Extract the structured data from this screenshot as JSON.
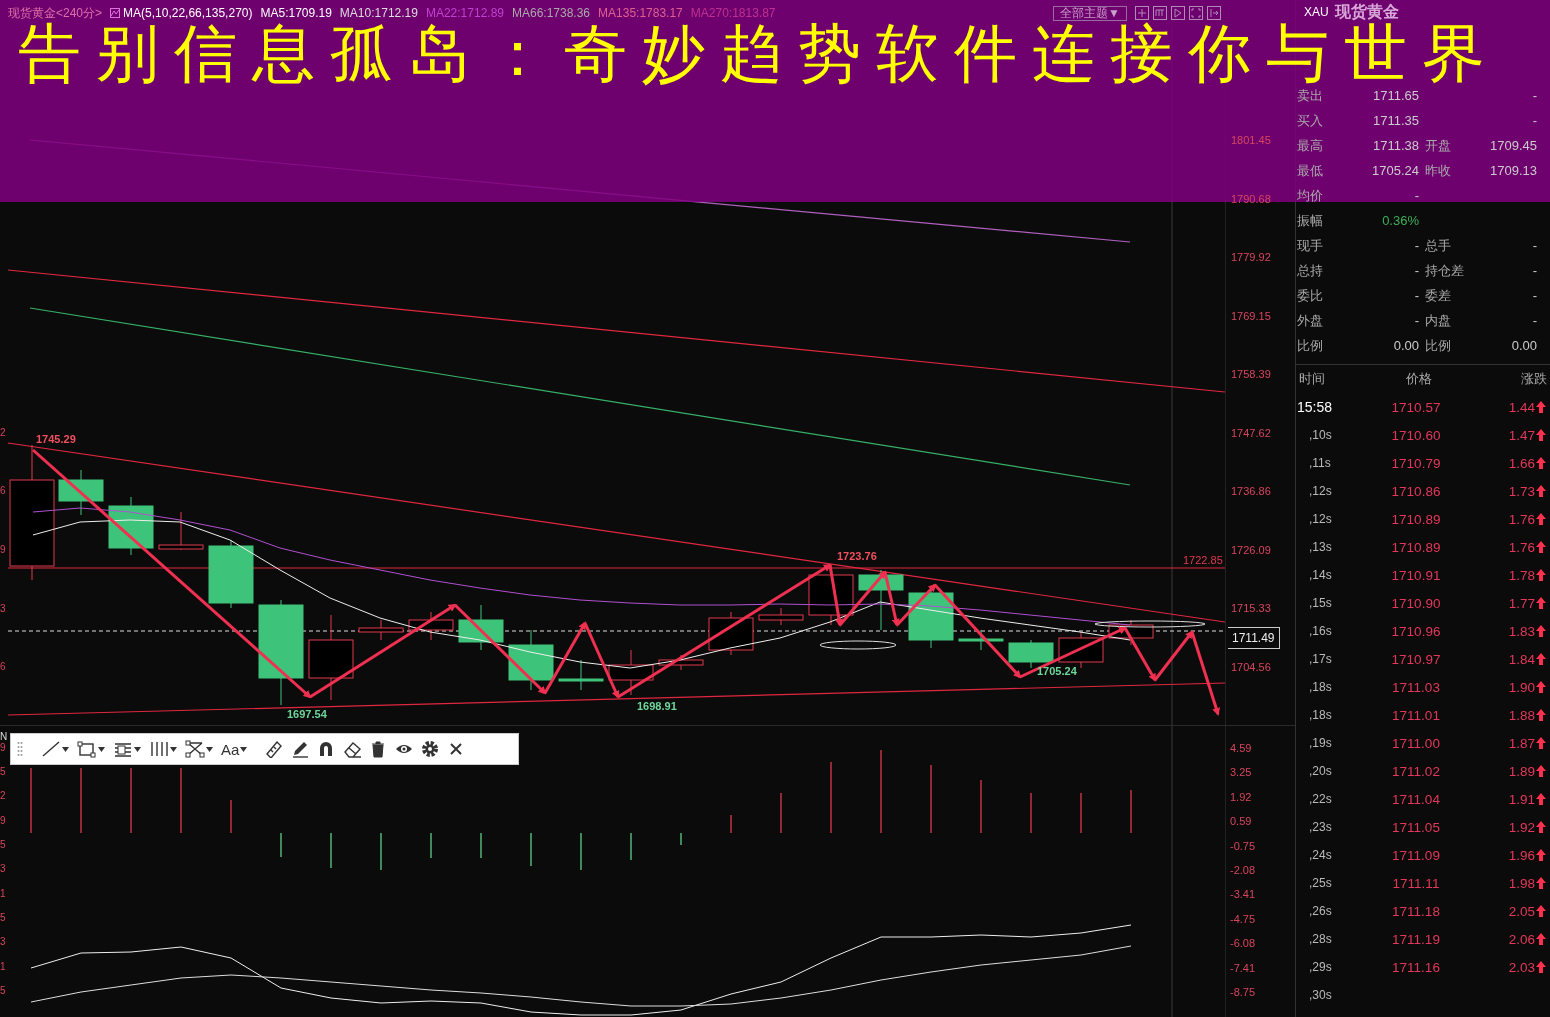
{
  "banner": {
    "title": "告别信息孤岛：奇妙趋势软件连接你与世界"
  },
  "header": {
    "symbol": "现货黄金<240分>",
    "indicator": "MA(5,10,22,66,135,270)",
    "ma_values": [
      {
        "text": "MA5:1709.19",
        "color": "#ffffff"
      },
      {
        "text": "MA10:1712.19",
        "color": "#dddddd"
      },
      {
        "text": "MA22:1712.89",
        "color": "#c040d0"
      },
      {
        "text": "MA66:1738.36",
        "color": "#aaaaaa"
      },
      {
        "text": "MA135:1783.17",
        "color": "#e06090"
      },
      {
        "text": "MA270:1813.87",
        "color": "#c03090"
      }
    ],
    "theme_button": "全部主题▼"
  },
  "main_chart": {
    "price_axis": [
      "1801.45",
      "1790.68",
      "1779.92",
      "1769.15",
      "1758.39",
      "1747.62",
      "1736.86",
      "1726.09",
      "1715.33",
      "1704.56"
    ],
    "current_price": "1711.49",
    "level_line_label": "1722.85",
    "price_marks": [
      {
        "text": "1745.29",
        "kind": "high"
      },
      {
        "text": "1697.54",
        "kind": "low"
      },
      {
        "text": "1698.91",
        "kind": "low"
      },
      {
        "text": "1723.76",
        "kind": "high"
      },
      {
        "text": "1705.24",
        "kind": "low"
      }
    ],
    "left_edge_labels": [
      "2",
      "6",
      "9",
      "3",
      "6"
    ]
  },
  "indicator": {
    "axis": [
      "4.59",
      "3.25",
      "1.92",
      "0.59",
      "-0.75",
      "-2.08",
      "-3.41",
      "-4.75",
      "-6.08",
      "-7.41",
      "-8.75"
    ],
    "left_edge_labels": [
      "N",
      "9",
      "5",
      "2",
      "9",
      "5",
      "3",
      "1",
      "5",
      "3",
      "1",
      "5"
    ]
  },
  "toolbar": {
    "text_tool": "Aa"
  },
  "quote": {
    "code": "XAU",
    "name": "现货黄金",
    "rows": [
      {
        "cells": [
          {
            "label": "卖出",
            "value": "1711.65"
          },
          {
            "value": "-"
          }
        ]
      },
      {
        "cells": [
          {
            "label": "买入",
            "value": "1711.35"
          },
          {
            "value": "-"
          }
        ]
      },
      {
        "cells": [
          {
            "label": "最高",
            "value": "1711.38"
          },
          {
            "label": "开盘",
            "value": "1709.45"
          }
        ]
      },
      {
        "cells": [
          {
            "label": "最低",
            "value": "1705.24"
          },
          {
            "label": "昨收",
            "value": "1709.13"
          }
        ]
      },
      {
        "cells": [
          {
            "label": "均价",
            "value": "-"
          }
        ]
      },
      {
        "cells": [
          {
            "label": "振幅",
            "value": "0.36%",
            "color": "#3fae5a"
          }
        ]
      },
      {
        "cells": [
          {
            "label": "现手",
            "value": "-"
          },
          {
            "label": "总手",
            "value": "-"
          }
        ]
      },
      {
        "cells": [
          {
            "label": "总持",
            "value": "-"
          },
          {
            "label": "持仓差",
            "value": "-"
          }
        ]
      },
      {
        "cells": [
          {
            "label": "委比",
            "value": "-"
          },
          {
            "label": "委差",
            "value": "-"
          }
        ]
      },
      {
        "cells": [
          {
            "label": "外盘",
            "value": "-"
          },
          {
            "label": "内盘",
            "value": "-"
          }
        ]
      },
      {
        "cells": [
          {
            "label": "比例",
            "value": "0.00"
          },
          {
            "label": "比例",
            "value": "0.00"
          }
        ]
      }
    ]
  },
  "ticks": {
    "columns": [
      "时间",
      "价格",
      "涨跌"
    ],
    "rows": [
      {
        "time": "15:58",
        "price": "1710.57",
        "change": "1.44",
        "kind": "minute"
      },
      {
        "time": ",10s",
        "price": "1710.60",
        "change": "1.47",
        "kind": "second"
      },
      {
        "time": ",11s",
        "price": "1710.79",
        "change": "1.66",
        "kind": "second"
      },
      {
        "time": ",12s",
        "price": "1710.86",
        "change": "1.73",
        "kind": "second"
      },
      {
        "time": ",12s",
        "price": "1710.89",
        "change": "1.76",
        "kind": "second"
      },
      {
        "time": ",13s",
        "price": "1710.89",
        "change": "1.76",
        "kind": "second"
      },
      {
        "time": ",14s",
        "price": "1710.91",
        "change": "1.78",
        "kind": "second"
      },
      {
        "time": ",15s",
        "price": "1710.90",
        "change": "1.77",
        "kind": "second"
      },
      {
        "time": ",16s",
        "price": "1710.96",
        "change": "1.83",
        "kind": "second"
      },
      {
        "time": ",17s",
        "price": "1710.97",
        "change": "1.84",
        "kind": "second"
      },
      {
        "time": ",18s",
        "price": "1711.03",
        "change": "1.90",
        "kind": "second"
      },
      {
        "time": ",18s",
        "price": "1711.01",
        "change": "1.88",
        "kind": "second"
      },
      {
        "time": ",19s",
        "price": "1711.00",
        "change": "1.87",
        "kind": "second"
      },
      {
        "time": ",20s",
        "price": "1711.02",
        "change": "1.89",
        "kind": "second"
      },
      {
        "time": ",22s",
        "price": "1711.04",
        "change": "1.91",
        "kind": "second"
      },
      {
        "time": ",23s",
        "price": "1711.05",
        "change": "1.92",
        "kind": "second"
      },
      {
        "time": ",24s",
        "price": "1711.09",
        "change": "1.96",
        "kind": "second"
      },
      {
        "time": ",25s",
        "price": "1711.11",
        "change": "1.98",
        "kind": "second"
      },
      {
        "time": ",26s",
        "price": "1711.18",
        "change": "2.05",
        "kind": "second"
      },
      {
        "time": ",28s",
        "price": "1711.19",
        "change": "2.06",
        "kind": "second"
      },
      {
        "time": ",29s",
        "price": "1711.16",
        "change": "2.03",
        "kind": "second"
      },
      {
        "time": ",30s",
        "kind": "second"
      }
    ]
  }
}
